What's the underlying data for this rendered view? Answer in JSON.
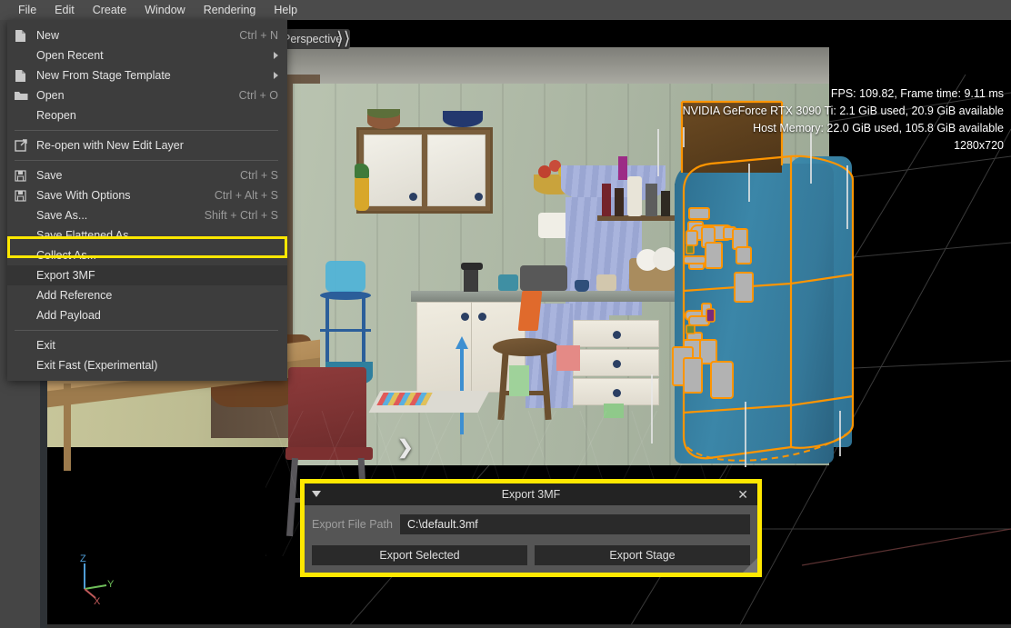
{
  "menubar": {
    "items": [
      {
        "label": "File",
        "active": true
      },
      {
        "label": "Edit",
        "active": false
      },
      {
        "label": "Create",
        "active": false
      },
      {
        "label": "Window",
        "active": false
      },
      {
        "label": "Rendering",
        "active": false
      },
      {
        "label": "Help",
        "active": false
      }
    ]
  },
  "file_menu": {
    "items": [
      {
        "icon": "document-icon",
        "label": "New",
        "accel": "Ctrl + N",
        "submenu": false,
        "separator_after": false
      },
      {
        "icon": "",
        "label": "Open Recent",
        "accel": "",
        "submenu": true,
        "separator_after": false
      },
      {
        "icon": "document-icon",
        "label": "New From Stage Template",
        "accel": "",
        "submenu": true,
        "separator_after": false
      },
      {
        "icon": "folder-icon",
        "label": "Open",
        "accel": "Ctrl + O",
        "submenu": false,
        "separator_after": false
      },
      {
        "icon": "",
        "label": "Reopen",
        "accel": "",
        "submenu": false,
        "separator_after": true
      },
      {
        "icon": "external-link-icon",
        "label": "Re-open with New Edit Layer",
        "accel": "",
        "submenu": false,
        "separator_after": true
      },
      {
        "icon": "save-icon",
        "label": "Save",
        "accel": "Ctrl + S",
        "submenu": false,
        "separator_after": false
      },
      {
        "icon": "save-icon",
        "label": "Save With Options",
        "accel": "Ctrl + Alt + S",
        "submenu": false,
        "separator_after": false
      },
      {
        "icon": "",
        "label": "Save As...",
        "accel": "Shift + Ctrl + S",
        "submenu": false,
        "separator_after": false
      },
      {
        "icon": "",
        "label": "Save Flattened As...",
        "accel": "",
        "submenu": false,
        "separator_after": false
      },
      {
        "icon": "",
        "label": "Collect As...",
        "accel": "",
        "submenu": false,
        "separator_after": false
      },
      {
        "icon": "",
        "label": "Export 3MF",
        "accel": "",
        "submenu": false,
        "separator_after": false,
        "highlighted": true
      },
      {
        "icon": "",
        "label": "Add Reference",
        "accel": "",
        "submenu": false,
        "separator_after": false
      },
      {
        "icon": "",
        "label": "Add Payload",
        "accel": "",
        "submenu": false,
        "separator_after": true
      },
      {
        "icon": "",
        "label": "Exit",
        "accel": "",
        "submenu": false,
        "separator_after": false
      },
      {
        "icon": "",
        "label": "Exit Fast (Experimental)",
        "accel": "",
        "submenu": false,
        "separator_after": false
      }
    ]
  },
  "viewport": {
    "camera_label": "Perspective",
    "expand_chevrons": "⟩⟩",
    "side_chevron": "❯",
    "axis_gizmo": {
      "x": "X",
      "y": "Y",
      "z": "Z"
    },
    "hud": {
      "line1": "FPS: 109.82, Frame time: 9.11 ms",
      "line2": "NVIDIA GeForce RTX 3090 Ti: 2.1 GiB used, 20.9 GiB available",
      "line3": "Host Memory: 22.0 GiB used, 105.8 GiB available",
      "line4": "1280x720"
    }
  },
  "dialog": {
    "title": "Export 3MF",
    "close_label": "✕",
    "path_label": "Export File Path",
    "path_value": "C:\\default.3mf",
    "path_placeholder": "C:\\default.3mf",
    "export_selected_label": "Export Selected",
    "export_stage_label": "Export Stage"
  },
  "colors": {
    "highlight_yellow": "#ffe800",
    "selection_orange": "#ff9500",
    "fridge_teal": "#35799a",
    "menu_bg": "#3d3d3d",
    "menubar_bg": "#4b4b4b",
    "dialog_bg": "#555555"
  }
}
